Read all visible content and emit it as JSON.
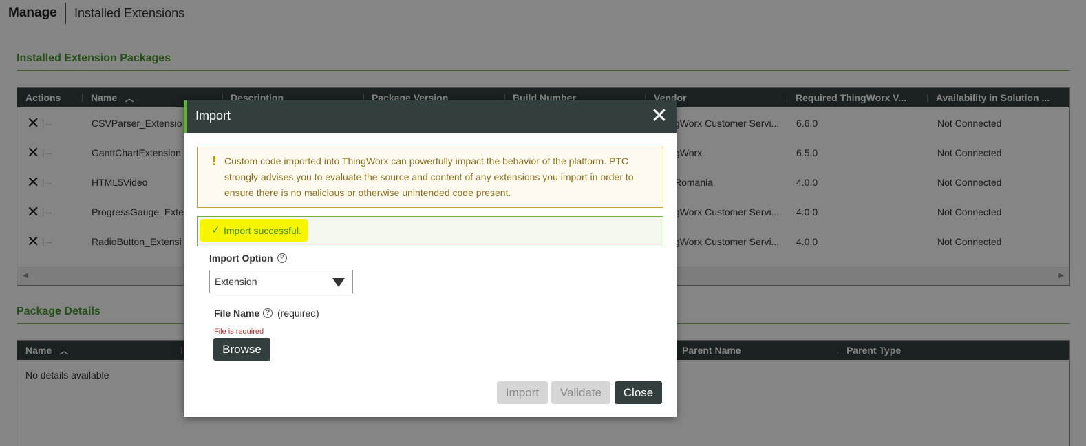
{
  "page_header": {
    "title": "Manage",
    "subtitle": "Installed Extensions"
  },
  "packages_section": {
    "title": "Installed Extension Packages",
    "columns": [
      {
        "label": "Actions"
      },
      {
        "label": "Name",
        "sorted": "ascending"
      },
      {
        "label": "Description"
      },
      {
        "label": "Package Version"
      },
      {
        "label": "Build Number"
      },
      {
        "label": "Vendor"
      },
      {
        "label": "Required ThingWorx V..."
      },
      {
        "label": "Availability in Solution ..."
      }
    ],
    "rows": [
      {
        "name": "CSVParser_Extensio",
        "vendor": "gWorx Customer Servi...",
        "required_version": "6.6.0",
        "availability": "Not Connected"
      },
      {
        "name": "GanttChartExtension",
        "vendor": "gWorx",
        "required_version": "6.5.0",
        "availability": "Not Connected"
      },
      {
        "name": "HTML5Video",
        "vendor": "Romania",
        "required_version": "4.0.0",
        "availability": "Not Connected"
      },
      {
        "name": "ProgressGauge_Exte",
        "vendor": "gWorx Customer Servi...",
        "required_version": "4.0.0",
        "availability": "Not Connected"
      },
      {
        "name": "RadioButton_Extensi",
        "vendor": "gWorx Customer Servi...",
        "required_version": "4.0.0",
        "availability": "Not Connected"
      }
    ],
    "icons": {
      "remove": "close-x-icon",
      "assign": "arrow-right-icon"
    }
  },
  "details_section": {
    "title": "Package Details",
    "columns": [
      {
        "label": "Name",
        "sorted": "ascending"
      },
      {
        "label": "Parent Name"
      },
      {
        "label": "Parent Type"
      }
    ],
    "empty_text": "No details available"
  },
  "modal": {
    "title": "Import",
    "close_icon": "close-icon",
    "warning": {
      "icon": "!",
      "text": "Custom code imported into ThingWorx can powerfully impact the behavior of the platform. PTC strongly advises you to evaluate the source and content of any extensions you import in order to ensure there is no malicious or otherwise unintended code present."
    },
    "success": {
      "icon": "✓",
      "text": "Import successful."
    },
    "import_option": {
      "label": "Import Option",
      "value": "Extension"
    },
    "file_name": {
      "label": "File Name",
      "required_note": "(required)",
      "error": "File is required",
      "browse_label": "Browse"
    },
    "buttons": {
      "import": "Import",
      "validate": "Validate",
      "close": "Close"
    }
  },
  "colors": {
    "header_dark": "#333f3e",
    "section_green": "#4a9a2e",
    "modal_accent": "#5cb233",
    "highlight_yellow": "#f6f600",
    "error_red": "#c62828"
  }
}
